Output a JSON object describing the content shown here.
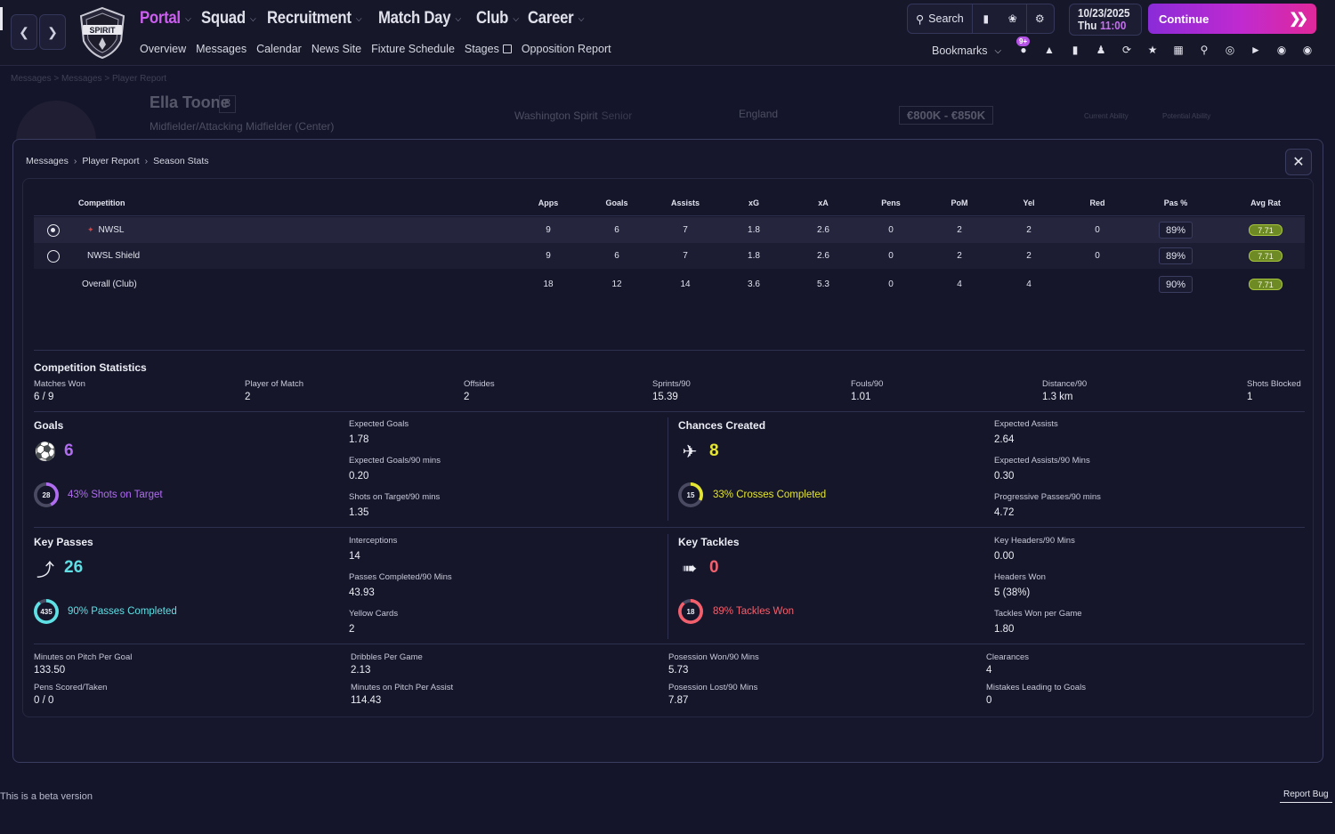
{
  "nav": {
    "menu": [
      {
        "label": "Portal",
        "active": true
      },
      {
        "label": "Squad",
        "active": false
      },
      {
        "label": "Recruitment",
        "active": false
      },
      {
        "label": "Match Day",
        "active": false
      },
      {
        "label": "Club",
        "active": false
      },
      {
        "label": "Career",
        "active": false
      }
    ],
    "submenu": [
      "Overview",
      "Messages",
      "Calendar",
      "News Site",
      "Fixture Schedule",
      "Stages",
      "Opposition Report"
    ],
    "crest_text": "SPIRIT",
    "search_label": "Search",
    "date": "10/23/2025",
    "day": "Thu",
    "time": "11:00",
    "continue_label": "Continue",
    "bookmarks_label": "Bookmarks",
    "badge": "9+",
    "accent_color": "#cc5ff0"
  },
  "background": {
    "crumb": "Messages  >  Messages  >  Player Report",
    "player_name": "Ella Toone",
    "shirt_number": "8",
    "position": "Midfielder/Attacking Midfielder (Center)",
    "club": "Washington Spirit",
    "club_status": "Senior",
    "nation": "England",
    "value": "€800K - €850K",
    "current_ability_label": "Current Ability",
    "potential_ability_label": "Potential Ability"
  },
  "modal": {
    "breadcrumb": [
      "Messages",
      "Player Report",
      "Season Stats"
    ],
    "close_label": "✕"
  },
  "table": {
    "headers": [
      "Competition",
      "Apps",
      "Goals",
      "Assists",
      "xG",
      "xA",
      "Pens",
      "PoM",
      "Yel",
      "Red",
      "Pas %",
      "Avg Rat"
    ],
    "rows": [
      {
        "competition": "NWSL",
        "apps": "9",
        "goals": "6",
        "assists": "7",
        "xg": "1.8",
        "xa": "2.6",
        "pens": "0",
        "pom": "2",
        "yel": "2",
        "red": "0",
        "pas": "89%",
        "rat": "7.71"
      },
      {
        "competition": "NWSL Shield",
        "apps": "9",
        "goals": "6",
        "assists": "7",
        "xg": "1.8",
        "xa": "2.6",
        "pens": "0",
        "pom": "2",
        "yel": "2",
        "red": "0",
        "pas": "89%",
        "rat": "7.71"
      },
      {
        "competition": "Overall (Club)",
        "apps": "18",
        "goals": "12",
        "assists": "14",
        "xg": "3.6",
        "xa": "5.3",
        "pens": "0",
        "pom": "4",
        "yel": "4",
        "red": "",
        "pas": "90%",
        "rat": "7.71"
      }
    ]
  },
  "competition_stats": {
    "title": "Competition Statistics",
    "items": [
      {
        "label": "Matches Won",
        "value": "6 / 9"
      },
      {
        "label": "Player of Match",
        "value": "2"
      },
      {
        "label": "Offsides",
        "value": "2"
      },
      {
        "label": "Sprints/90",
        "value": "15.39"
      },
      {
        "label": "Fouls/90",
        "value": "1.01"
      },
      {
        "label": "Distance/90",
        "value": "1.3 km"
      },
      {
        "label": "Shots Blocked",
        "value": "1"
      }
    ]
  },
  "goals": {
    "title": "Goals",
    "icon": "ball-icon",
    "value": "6",
    "color": "#b06df0",
    "ring_value": "28",
    "ring_percent": 43,
    "ring_text": "43% Shots on Target",
    "stats": [
      {
        "label": "Expected Goals",
        "value": "1.78"
      },
      {
        "label": "Expected Goals/90 mins",
        "value": "0.20"
      },
      {
        "label": "Shots on Target/90 mins",
        "value": "1.35"
      }
    ]
  },
  "chances": {
    "title": "Chances Created",
    "icon": "boot-icon",
    "value": "8",
    "color": "#e4e534",
    "ring_value": "15",
    "ring_percent": 33,
    "ring_text": "33% Crosses Completed",
    "stats": [
      {
        "label": "Expected Assists",
        "value": "2.64"
      },
      {
        "label": "Expected Assists/90 Mins",
        "value": "0.30"
      },
      {
        "label": "Progressive Passes/90 mins",
        "value": "4.72"
      }
    ]
  },
  "key_passes": {
    "title": "Key Passes",
    "icon": "pass-icon",
    "value": "26",
    "color": "#5fe0e4",
    "ring_value": "435",
    "ring_percent": 90,
    "ring_text": "90% Passes Completed",
    "stats": [
      {
        "label": "Interceptions",
        "value": "14"
      },
      {
        "label": "Passes Completed/90 Mins",
        "value": "43.93"
      },
      {
        "label": "Yellow Cards",
        "value": "2"
      }
    ]
  },
  "key_tackles": {
    "title": "Key Tackles",
    "icon": "tackle-icon",
    "value": "0",
    "color": "#f2606e",
    "ring_value": "18",
    "ring_percent": 89,
    "ring_text": "89% Tackles Won",
    "stats": [
      {
        "label": "Key Headers/90 Mins",
        "value": "0.00"
      },
      {
        "label": "Headers Won",
        "value": "5 (38%)"
      },
      {
        "label": "Tackles Won per Game",
        "value": "1.80"
      }
    ]
  },
  "bottom_stats": [
    {
      "label": "Minutes on Pitch Per Goal",
      "value": "133.50"
    },
    {
      "label": "Dribbles Per Game",
      "value": "2.13"
    },
    {
      "label": "Posession Won/90 Mins",
      "value": "5.73"
    },
    {
      "label": "Clearances",
      "value": "4"
    },
    {
      "label": "Pens Scored/Taken",
      "value": "0 / 0"
    },
    {
      "label": "Minutes on Pitch Per Assist",
      "value": "114.43"
    },
    {
      "label": "Posession Lost/90 Mins",
      "value": "7.87"
    },
    {
      "label": "Mistakes Leading to Goals",
      "value": "0"
    }
  ],
  "footer": {
    "beta": "This is a beta version",
    "report_bug": "Report Bug"
  }
}
